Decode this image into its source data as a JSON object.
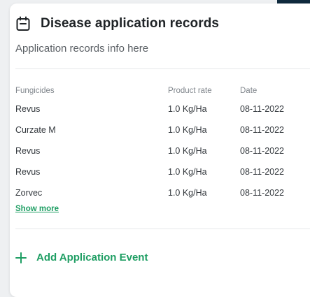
{
  "card": {
    "title": "Disease application records",
    "subtitle": "Application records info here"
  },
  "table": {
    "headers": {
      "fungicides": "Fungicides",
      "product_rate": "Product rate",
      "date": "Date"
    },
    "rows": [
      {
        "fungicide": "Revus",
        "rate": "1.0 Kg/Ha",
        "date": "08-11-2022"
      },
      {
        "fungicide": "Curzate M",
        "rate": "1.0 Kg/Ha",
        "date": "08-11-2022"
      },
      {
        "fungicide": "Revus",
        "rate": "1.0 Kg/Ha",
        "date": "08-11-2022"
      },
      {
        "fungicide": "Revus",
        "rate": "1.0 Kg/Ha",
        "date": "08-11-2022"
      },
      {
        "fungicide": "Zorvec",
        "rate": "1.0 Kg/Ha",
        "date": "08-11-2022"
      }
    ]
  },
  "show_more_label": "Show more",
  "add_event_label": "Add Application Event",
  "icons": {
    "header": "calendar-icon",
    "add": "plus-icon"
  },
  "colors": {
    "accent": "#1e9e63",
    "title": "#1f2326"
  }
}
